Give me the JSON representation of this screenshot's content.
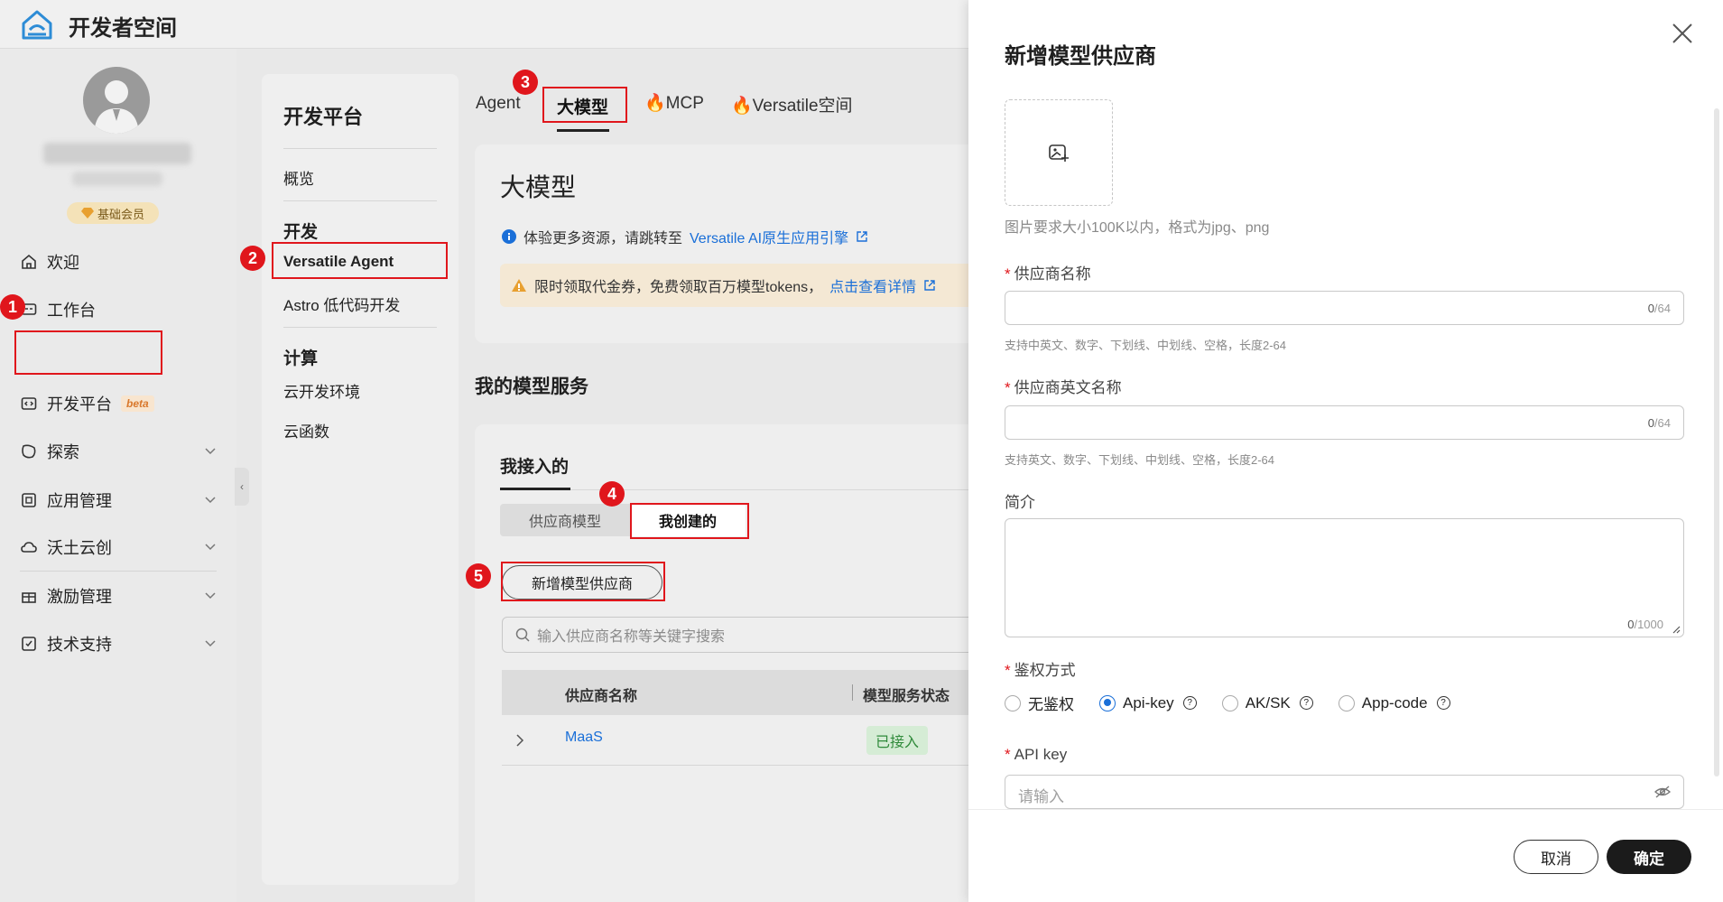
{
  "app": {
    "title": "开发者空间"
  },
  "profile": {
    "member_label": "基础会员"
  },
  "leftnav": {
    "items": [
      {
        "label": "欢迎",
        "icon": "home-icon"
      },
      {
        "label": "工作台",
        "icon": "workbench-icon"
      },
      {
        "label": "开发平台",
        "icon": "code-icon",
        "badge": "beta"
      },
      {
        "label": "探索",
        "icon": "explore-icon"
      },
      {
        "label": "应用管理",
        "icon": "app-icon"
      },
      {
        "label": "沃土云创",
        "icon": "cloud-icon"
      },
      {
        "label": "激励管理",
        "icon": "gift-icon"
      },
      {
        "label": "技术支持",
        "icon": "support-icon"
      }
    ],
    "collapse_glyph": "‹"
  },
  "subnav": {
    "title": "开发平台",
    "overview": "概览",
    "group_dev": "开发",
    "item_versatile": "Versatile Agent",
    "item_astro": "Astro 低代码开发",
    "group_compute": "计算",
    "item_cloud_env": "云开发环境",
    "item_cloud_fn": "云函数"
  },
  "tabs": {
    "agent": "Agent",
    "llm": "大模型",
    "mcp": "MCP",
    "versatile_space": "Versatile空间"
  },
  "main": {
    "title": "大模型",
    "info_prefix": "体验更多资源，请跳转至",
    "info_link": "Versatile AI原生应用引擎",
    "warn_text": "限时领取代金券，免费领取百万模型tokens，",
    "warn_link": "点击查看详情",
    "section_title": "我的模型服务",
    "card_head": "我接入的",
    "seg_provider": "供应商模型",
    "seg_mine": "我创建的",
    "add_button": "新增模型供应商",
    "search_placeholder": "输入供应商名称等关键字搜索",
    "table": {
      "columns": [
        "供应商名称",
        "模型服务状态"
      ],
      "rows": [
        {
          "name": "MaaS",
          "status": "已接入"
        }
      ]
    }
  },
  "annotations": [
    "1",
    "2",
    "3",
    "4",
    "5"
  ],
  "drawer": {
    "title": "新增模型供应商",
    "image_hint": "图片要求大小100K以内，格式为jpg、png",
    "provider_name_label": "供应商名称",
    "provider_name_counter": "0",
    "provider_name_max": "/64",
    "provider_name_hint": "支持中英文、数字、下划线、中划线、空格，长度2-64",
    "provider_en_label": "供应商英文名称",
    "provider_en_counter": "0",
    "provider_en_max": "/64",
    "provider_en_hint": "支持英文、数字、下划线、中划线、空格，长度2-64",
    "intro_label": "简介",
    "intro_counter": "0",
    "intro_max": "/1000",
    "auth_label": "鉴权方式",
    "auth_options": [
      "无鉴权",
      "Api-key",
      "AK/SK",
      "App-code"
    ],
    "auth_selected": "Api-key",
    "apikey_label": "API key",
    "apikey_placeholder": "请输入",
    "cancel": "取消",
    "confirm": "确定"
  },
  "colors": {
    "accent": "#1a6fd8",
    "annotation": "#e0161c",
    "primary_button": "#1b1b1b"
  }
}
